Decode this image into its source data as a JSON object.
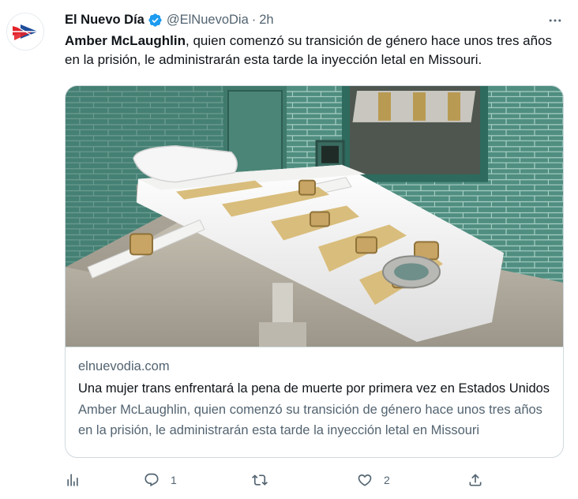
{
  "author": {
    "display_name": "El Nuevo Día",
    "handle": "@ElNuevoDia",
    "separator": "·",
    "time": "2h",
    "avatar_icon": "el-nuevo-dia-logo",
    "verified_icon": "verified-badge-icon",
    "brand_colors": {
      "red": "#e3232a",
      "blue": "#1d4d9a"
    }
  },
  "tweet": {
    "bold_name": "Amber McLaughlin",
    "text_rest": ", quien comenzó su transición de género hace unos tres años en la prisión, le administrarán esta tarde la inyección letal en Missouri."
  },
  "card": {
    "image_alt": "execution-chamber-gurney-photo",
    "domain": "elnuevodia.com",
    "title": "Una mujer trans enfrentará la pena de muerte por primera vez en Estados Unidos",
    "description": "Amber McLaughlin, quien comenzó su transición de género hace unos tres años en la prisión, le administrarán esta tarde la inyección letal en Missouri"
  },
  "actions": {
    "views_icon": "analytics-icon",
    "reply_icon": "reply-icon",
    "reply_count": "1",
    "retweet_icon": "retweet-icon",
    "retweet_count": "",
    "like_icon": "heart-icon",
    "like_count": "2",
    "share_icon": "share-icon"
  },
  "colors": {
    "text_primary": "#0f1419",
    "text_secondary": "#536471",
    "border": "#cfd9de",
    "verified_blue": "#1d9bf0"
  }
}
